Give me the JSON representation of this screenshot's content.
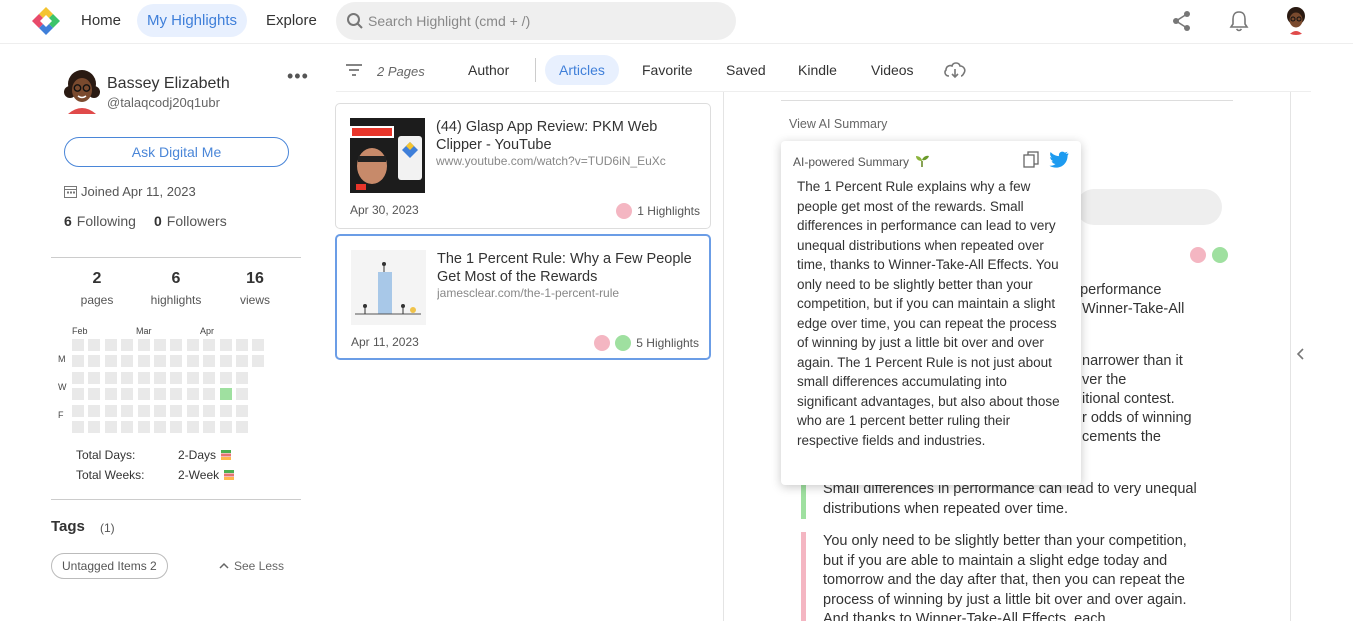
{
  "nav": {
    "home": "Home",
    "my_highlights": "My Highlights",
    "explore": "Explore",
    "search_placeholder": "Search Highlight (cmd + /)"
  },
  "profile": {
    "name": "Bassey Elizabeth",
    "handle": "@talaqcodj20q1ubr",
    "more": "•••",
    "ask_button": "Ask Digital Me",
    "joined": "Joined Apr 11, 2023",
    "following_count": "6",
    "following_label": "Following",
    "followers_count": "0",
    "followers_label": "Followers"
  },
  "stats": [
    {
      "num": "2",
      "label": "pages"
    },
    {
      "num": "6",
      "label": "highlights"
    },
    {
      "num": "16",
      "label": "views"
    }
  ],
  "heatmap": {
    "months": [
      "Feb",
      "Mar",
      "Apr"
    ],
    "days": [
      "M",
      "W",
      "F"
    ],
    "active_cells": [
      [
        12,
        1
      ],
      [
        9,
        3
      ]
    ],
    "active_color": "#9fe0a0"
  },
  "totals": {
    "days_label": "Total Days:",
    "days_value": "2-Days",
    "weeks_label": "Total Weeks:",
    "weeks_value": "2-Week"
  },
  "tags": {
    "title": "Tags",
    "count": "(1)",
    "chip": "Untagged Items 2",
    "see_less": "See Less"
  },
  "filters": {
    "pages": "2 Pages",
    "tabs": [
      "Author",
      "Articles",
      "Favorite",
      "Saved",
      "Kindle",
      "Videos"
    ],
    "active": "Articles"
  },
  "cards": [
    {
      "title": "(44) Glasp App Review: PKM Web Clipper - YouTube",
      "url": "www.youtube.com/watch?v=TUD6iN_EuXc",
      "date": "Apr 30, 2023",
      "highlights": "1 Highlights",
      "dots": [
        "#f4b6c2"
      ]
    },
    {
      "title": "The 1 Percent Rule: Why a Few People Get Most of the Rewards",
      "url": "jamesclear.com/the-1-percent-rule",
      "date": "Apr 11, 2023",
      "highlights": "5 Highlights",
      "dots": [
        "#f4b6c2",
        "#9fe0a0"
      ]
    }
  ],
  "right_pane": {
    "view_ai": "View AI Summary",
    "partial_lines": [
      "n performance",
      "Winner-Take-All",
      "narrower than it",
      "ver the",
      "itional contest.",
      "r odds of winning",
      "cements the"
    ],
    "quote1": "Small differences in performance can lead to very unequal distributions when repeated over time.",
    "quote2": "You only need to be slightly better than your competition, but if you are able to maintain a slight edge today and tomorrow and the day after that, then you can repeat the process of winning by just a little bit over and over again. And thanks to Winner-Take-All Effects, each"
  },
  "summary": {
    "title": "AI-powered Summary",
    "body": "The 1 Percent Rule explains why a few people get most of the rewards. Small differences in performance can lead to very unequal distributions when repeated over time, thanks to Winner-Take-All Effects. You only need to be slightly better than your competition, but if you can maintain a slight edge over time, you can repeat the process of winning by just a little bit over and over again. The 1 Percent Rule is not just about small differences accumulating into significant advantages, but also about those who are 1 percent better ruling their respective fields and industries."
  },
  "colors": {
    "accent": "#3f7fd9",
    "pink": "#f4b6c2",
    "green": "#9fe0a0",
    "twitter": "#1d9bf0"
  }
}
